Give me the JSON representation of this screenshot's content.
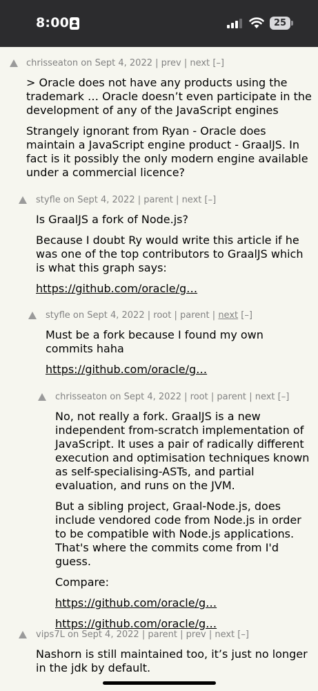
{
  "status_bar": {
    "time": "8:00",
    "battery": "25"
  },
  "comments": [
    {
      "meta": {
        "user": "chrisseaton",
        "on": "on",
        "date": "Sept 4, 2022",
        "sep1": "|",
        "link1": "prev",
        "sep2": "|",
        "link2": "next",
        "toggle": "[–]"
      },
      "paragraphs": [
        "> Oracle does not have any products using the trademark … Oracle doesn’t even participate in the development of any of the JavaScript engines",
        "Strangely ignorant from Ryan - Oracle does maintain a JavaScript engine product - GraalJS. In fact is it possibly the only modern engine available under a commercial licence?"
      ]
    },
    {
      "meta": {
        "user": "styfle",
        "on": "on",
        "date": "Sept 4, 2022",
        "sep1": "|",
        "link1": "parent",
        "sep2": "|",
        "link2": "next",
        "toggle": "[–]"
      },
      "paragraphs": [
        "Is GraalJS a fork of Node.js?",
        "Because I doubt Ry would write this article if he was one of the top contributors to GraalJS which is what this graph says:"
      ],
      "links": [
        "https://github.com/oracle/g…"
      ]
    },
    {
      "meta": {
        "user": "styfle",
        "on": "on",
        "date": "Sept 4, 2022",
        "sep1": "|",
        "link1": "root",
        "sep2": "|",
        "link2": "parent",
        "sep3": "|",
        "link3": "next",
        "toggle": "[–]"
      },
      "paragraphs": [
        "Must be a fork because I found my own commits haha"
      ],
      "links": [
        "https://github.com/oracle/g…"
      ]
    },
    {
      "meta": {
        "user": "chrisseaton",
        "on": "on",
        "date": "Sept 4, 2022",
        "sep1": "|",
        "link1": "root",
        "sep2": "|",
        "link2": "parent",
        "sep3": "|",
        "link3": "next",
        "toggle": "[–]"
      },
      "paragraphs": [
        "No, not really a fork. GraalJS is a new independent from-scratch implementation of JavaScript. It uses a pair of radically different execution and optimisation techniques known as self-specialising-ASTs, and partial evaluation, and runs on the JVM.",
        "But a sibling project, Graal-Node.js, does include vendored code from Node.js in order to be compatible with Node.js applications. That's where the commits come from I'd guess.",
        "Compare:"
      ],
      "links": [
        "https://github.com/oracle/g…",
        "https://github.com/oracle/g…"
      ]
    },
    {
      "meta": {
        "user": "vips7L",
        "on": "on",
        "date": "Sept 4, 2022",
        "sep1": "|",
        "link1": "parent",
        "sep2": "|",
        "link2": "prev",
        "sep3": "|",
        "link3": "next",
        "toggle": "[–]"
      },
      "paragraphs": [
        "Nashorn is still maintained too, it’s just no longer in the jdk by default."
      ]
    }
  ]
}
